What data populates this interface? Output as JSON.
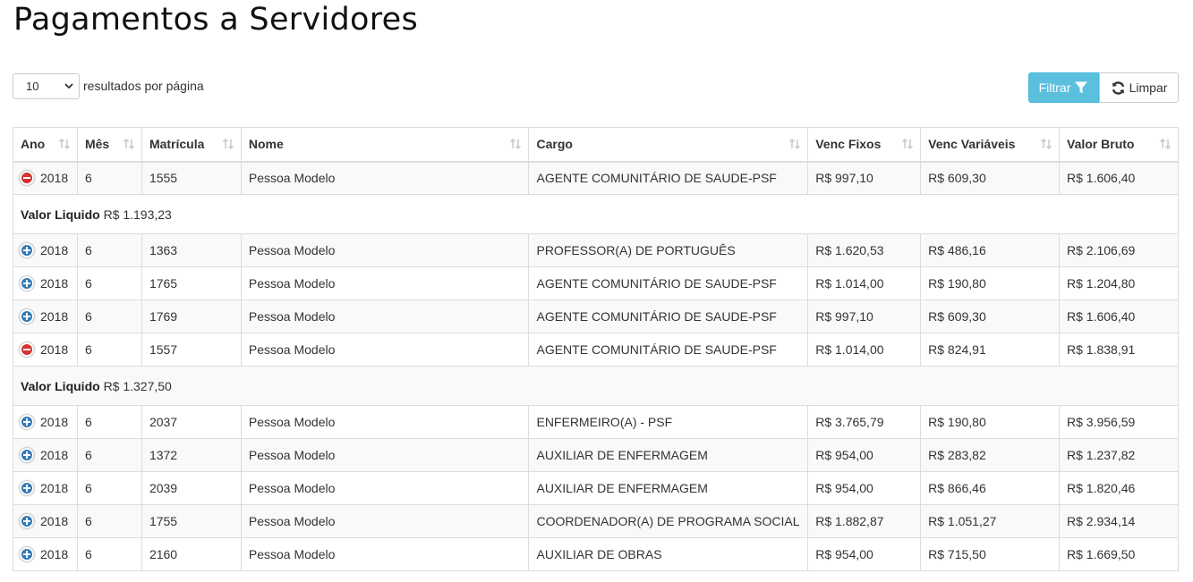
{
  "page": {
    "title": "Pagamentos a Servidores"
  },
  "controls": {
    "page_length_value": "10",
    "page_length_label": "resultados por página",
    "filter_label": "Filtrar",
    "clear_label": "Limpar"
  },
  "table": {
    "headers": {
      "ano": "Ano",
      "mes": "Mês",
      "matricula": "Matrícula",
      "nome": "Nome",
      "cargo": "Cargo",
      "venc_fixos": "Venc Fixos",
      "venc_variaveis": "Venc Variáveis",
      "valor_bruto": "Valor Bruto"
    },
    "child_label": "Valor Liquido",
    "rows": [
      {
        "expanded": true,
        "ano": "2018",
        "mes": "6",
        "matricula": "1555",
        "nome": "Pessoa Modelo",
        "cargo": "AGENTE COMUNITÁRIO DE SAUDE-PSF",
        "venc_fixos": "R$ 997,10",
        "venc_variaveis": "R$ 609,30",
        "valor_bruto": "R$ 1.606,40",
        "valor_liquido": "R$ 1.193,23"
      },
      {
        "expanded": false,
        "ano": "2018",
        "mes": "6",
        "matricula": "1363",
        "nome": "Pessoa Modelo",
        "cargo": "PROFESSOR(A) DE PORTUGUÊS",
        "venc_fixos": "R$ 1.620,53",
        "venc_variaveis": "R$ 486,16",
        "valor_bruto": "R$ 2.106,69"
      },
      {
        "expanded": false,
        "ano": "2018",
        "mes": "6",
        "matricula": "1765",
        "nome": "Pessoa Modelo",
        "cargo": "AGENTE COMUNITÁRIO DE SAUDE-PSF",
        "venc_fixos": "R$ 1.014,00",
        "venc_variaveis": "R$ 190,80",
        "valor_bruto": "R$ 1.204,80"
      },
      {
        "expanded": false,
        "ano": "2018",
        "mes": "6",
        "matricula": "1769",
        "nome": "Pessoa Modelo",
        "cargo": "AGENTE COMUNITÁRIO DE SAUDE-PSF",
        "venc_fixos": "R$ 997,10",
        "venc_variaveis": "R$ 609,30",
        "valor_bruto": "R$ 1.606,40"
      },
      {
        "expanded": true,
        "ano": "2018",
        "mes": "6",
        "matricula": "1557",
        "nome": "Pessoa Modelo",
        "cargo": "AGENTE COMUNITÁRIO DE SAUDE-PSF",
        "venc_fixos": "R$ 1.014,00",
        "venc_variaveis": "R$ 824,91",
        "valor_bruto": "R$ 1.838,91",
        "valor_liquido": "R$ 1.327,50"
      },
      {
        "expanded": false,
        "ano": "2018",
        "mes": "6",
        "matricula": "2037",
        "nome": "Pessoa Modelo",
        "cargo": "ENFERMEIRO(A) - PSF",
        "venc_fixos": "R$ 3.765,79",
        "venc_variaveis": "R$ 190,80",
        "valor_bruto": "R$ 3.956,59"
      },
      {
        "expanded": false,
        "ano": "2018",
        "mes": "6",
        "matricula": "1372",
        "nome": "Pessoa Modelo",
        "cargo": "AUXILIAR DE ENFERMAGEM",
        "venc_fixos": "R$ 954,00",
        "venc_variaveis": "R$ 283,82",
        "valor_bruto": "R$ 1.237,82"
      },
      {
        "expanded": false,
        "ano": "2018",
        "mes": "6",
        "matricula": "2039",
        "nome": "Pessoa Modelo",
        "cargo": "AUXILIAR DE ENFERMAGEM",
        "venc_fixos": "R$ 954,00",
        "venc_variaveis": "R$ 866,46",
        "valor_bruto": "R$ 1.820,46"
      },
      {
        "expanded": false,
        "ano": "2018",
        "mes": "6",
        "matricula": "1755",
        "nome": "Pessoa Modelo",
        "cargo": "COORDENADOR(A) DE PROGRAMA SOCIAL",
        "venc_fixos": "R$ 1.882,87",
        "venc_variaveis": "R$ 1.051,27",
        "valor_bruto": "R$ 2.934,14"
      },
      {
        "expanded": false,
        "ano": "2018",
        "mes": "6",
        "matricula": "2160",
        "nome": "Pessoa Modelo",
        "cargo": "AUXILIAR DE OBRAS",
        "venc_fixos": "R$ 954,00",
        "venc_variaveis": "R$ 715,50",
        "valor_bruto": "R$ 1.669,50"
      }
    ]
  }
}
